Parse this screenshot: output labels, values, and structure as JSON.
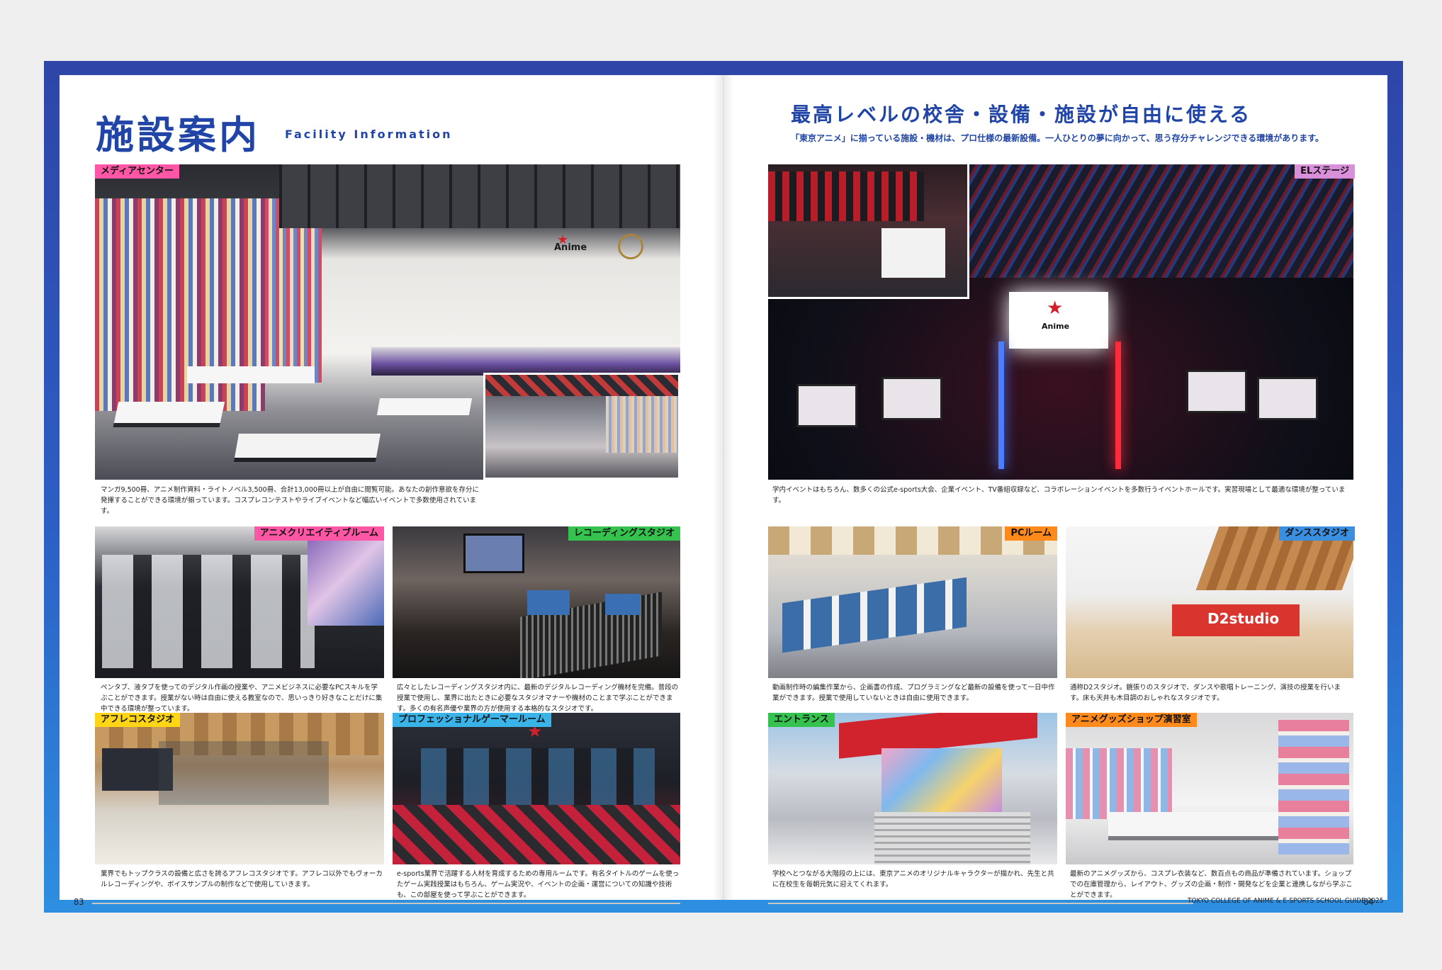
{
  "left": {
    "title": "施設案内",
    "subtitle": "Facility Information",
    "page_number": "83",
    "sections": [
      {
        "tag": "メディアセンター",
        "caption": "マンガ9,500冊、アニメ制作資料・ライトノベル3,500冊、合計13,000冊以上が自由に閲覧可能。あなたの創作意欲を存分に発揮することができる環境が揃っています。コスプレコンテストやライブイベントなど幅広いイベントで多数使用されています。",
        "color": "#ff57a5"
      },
      {
        "tag": "アニメクリエイティブルーム",
        "caption": "ペンタブ、液タブを使ってのデジタル作画の授業や、アニメビジネスに必要なPCスキルを学ぶことができます。授業がない時は自由に使える教室なので、思いっきり好きなことだけに集中できる環境が整っています。",
        "color": "#ff57a5"
      },
      {
        "tag": "レコーディングスタジオ",
        "caption": "広々としたレコーディングスタジオ内に、最新のデジタルレコーディング機材を完備。普段の授業で使用し、業界に出たときに必要なスタジオマナーや機材のことまで学ぶことができます。多くの有名声優や業界の方が使用する本格的なスタジオです。",
        "color": "#36c24f"
      },
      {
        "tag": "アフレコスタジオ",
        "caption": "業界でもトップクラスの設備と広さを誇るアフレコスタジオです。アフレコ以外でもヴォーカルレコーディングや、ボイスサンプルの制作などで使用していきます。",
        "color": "#ffd515"
      },
      {
        "tag": "プロフェッショナルゲーマールーム",
        "caption": "e-sports業界で活躍する人材を育成するための専用ルームです。有名タイトルのゲームを使ったゲーム実践授業はもちろん、ゲーム実況や、イベントの企画・運営についての知識や技術も、この部屋を使って学ぶことができます。",
        "color": "#3ab3e8"
      }
    ]
  },
  "right": {
    "title": "最高レベルの校舎・設備・施設が自由に使える",
    "lead_prefix": "「東京アニメ」",
    "lead": "に揃っている施設・機材は、プロ仕様の最新設備。一人ひとりの夢に向かって、思う存分チャレンジできる環境があります。",
    "page_number": "84",
    "footer_text": "TOKYO COLLEGE OF ANIME & E-SPORTS  SCHOOL GUIDE 2025",
    "sections": [
      {
        "tag": "ELステージ",
        "caption": "学内イベントはもちろん、数多くの公式e-sports大会、企業イベント、TV番組収録など、コラボレーションイベントを多数行うイベントホールです。実習現場として最適な環境が整っています。",
        "color": "#d98fd9"
      },
      {
        "tag": "PCルーム",
        "caption": "動画制作時の編集作業から、企画書の作成、プログラミングなど最新の設備を使って一日中作業ができます。授業で使用していないときは自由に使用できます。",
        "color": "#ff8a1c"
      },
      {
        "tag": "ダンススタジオ",
        "caption": "通称D2スタジオ。鏡張りのスタジオで、ダンスや歌唱トレーニング、演技の授業を行います。床も天井も木目調のおしゃれなスタジオです。",
        "color": "#3a8fe0"
      },
      {
        "tag": "エントランス",
        "caption": "学校へとつながる大階段の上には、東京アニメのオリジナルキャラクターが描かれ、先生と共に在校生を毎朝元気に迎えてくれます。",
        "color": "#36c24f"
      },
      {
        "tag": "アニメグッズショップ演習室",
        "caption": "最新のアニメグッズから、コスプレ衣装など、数百点もの商品が準備されています。ショップでの在庫管理から、レイアウト、グッズの企画・制作・開発などを企業と連携しながら学ぶことができます。",
        "color": "#ff8a1c"
      }
    ]
  },
  "photo_text": {
    "anime_logo": "Anime",
    "d2_sign": "D2studio"
  }
}
